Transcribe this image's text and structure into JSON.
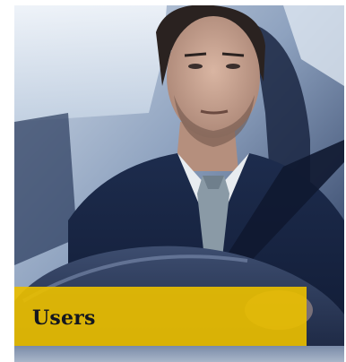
{
  "card": {
    "caption": "Users",
    "caption_color": "#e9be00"
  },
  "photo": {
    "subject": "businessman-driving-car"
  }
}
